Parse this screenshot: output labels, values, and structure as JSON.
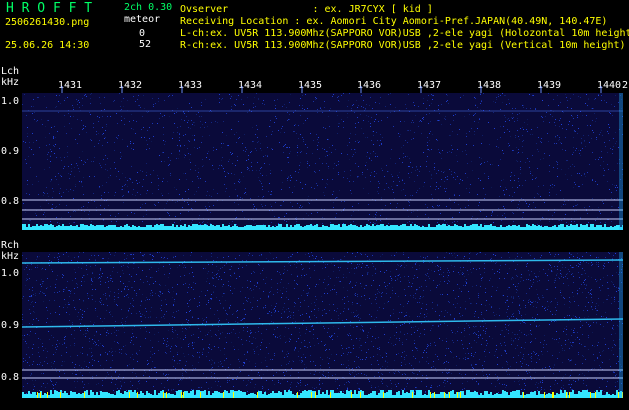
{
  "header": {
    "app_title": "H R O F F T",
    "version": "2ch 0.30",
    "filename": "2506261430.png",
    "meteor_label": "meteor",
    "meteor_l_count": "0",
    "datetime": "25.06.26 14:30",
    "meteor_r_count": "52",
    "observer_line": "Ovserver              : ex. JR7CYX [ kid ]",
    "location_line": "Receiving Location : ex. Aomori City Aomori-Pref.JAPAN(40.49N, 140.47E)",
    "lch_line": "L-ch:ex. UV5R 113.900Mhz(SAPPORO VOR)USB ,2-ele yagi (Holozontal 10m height)",
    "rch_line": "R-ch:ex. UV5R 113.900Mhz(SAPPORO VOR)USB ,2-ele yagi (Vertical 10m height)"
  },
  "time_axis": {
    "ticks": [
      "1431",
      "1432",
      "1433",
      "1434",
      "1435",
      "1436",
      "1437",
      "1438",
      "1439",
      "1440",
      "2"
    ]
  },
  "left_channel": {
    "label": "Lch",
    "unit": "kHz",
    "y_ticks": [
      "1.0",
      "0.9",
      "0.8"
    ]
  },
  "right_channel": {
    "label": "Rch",
    "unit": "kHz",
    "y_ticks": [
      "1.0",
      "0.9",
      "0.8"
    ]
  },
  "colors": {
    "green": "#00ff66",
    "yellow": "#ffff00",
    "white": "#ffffff",
    "cyan": "#33e5ff",
    "spectrum_bg": "#0a0a3a"
  }
}
